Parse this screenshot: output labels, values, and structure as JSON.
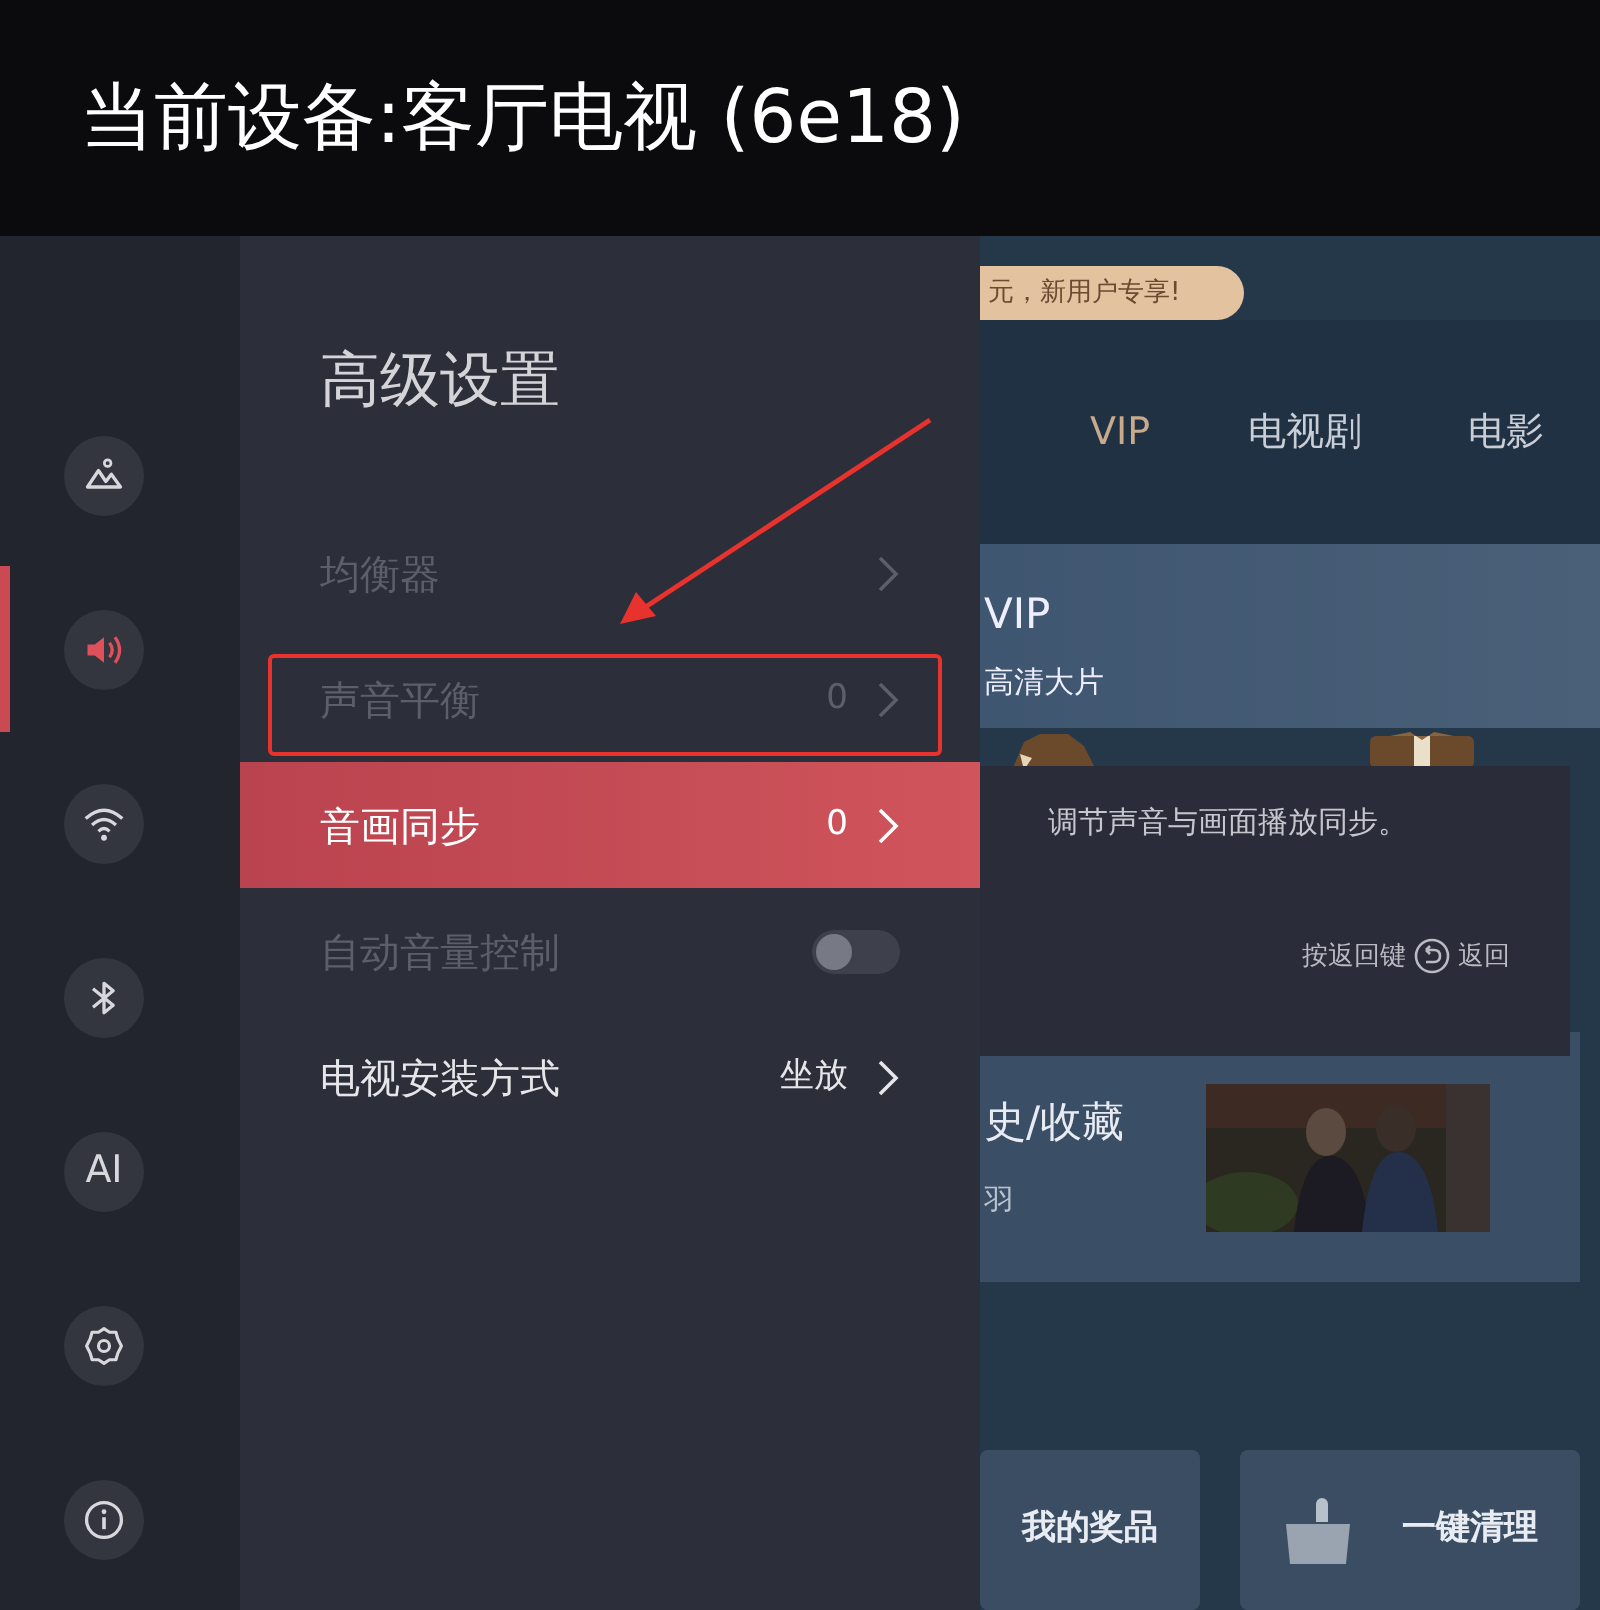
{
  "header": {
    "title": "当前设备:客厅电视 (6e18)"
  },
  "rail": [
    {
      "kind": "picture",
      "selected": false
    },
    {
      "kind": "sound",
      "selected": true
    },
    {
      "kind": "wifi",
      "selected": false
    },
    {
      "kind": "bluetooth",
      "selected": false
    },
    {
      "kind": "text",
      "label": "AI",
      "selected": false
    },
    {
      "kind": "gear",
      "selected": false
    },
    {
      "kind": "info",
      "selected": false
    }
  ],
  "panel": {
    "title": "高级设置",
    "rows": [
      {
        "kind": "link",
        "label": "均衡器",
        "disabled": true,
        "selected": false
      },
      {
        "kind": "link",
        "label": "声音平衡",
        "value": "0",
        "disabled": true,
        "selected": false
      },
      {
        "kind": "link",
        "label": "音画同步",
        "value": "0",
        "disabled": false,
        "selected": true
      },
      {
        "kind": "toggle",
        "label": "自动音量控制",
        "on": false,
        "disabled": true,
        "selected": false
      },
      {
        "kind": "link",
        "label": "电视安装方式",
        "value": "坐放",
        "disabled": false,
        "selected": false
      }
    ]
  },
  "tooltip": {
    "text": "调节声音与画面播放同步。",
    "hint": "按返回键",
    "back": "返回"
  },
  "home": {
    "promo": "元，新用户专享!",
    "tabs": [
      {
        "label": "VIP",
        "color": "#c8a98a"
      },
      {
        "label": "电视剧",
        "color": "#c9ced6"
      },
      {
        "label": "电影",
        "color": "#c9ced6"
      }
    ],
    "vip_card": {
      "title": "VIP",
      "subtitle": "高清大片"
    },
    "history_card": {
      "title": "史/收藏",
      "subtitle": "羽",
      "poster": {
        "kind": "picture"
      }
    },
    "tiles": [
      {
        "label": "我的奖品"
      },
      {
        "label": "一键清理",
        "kind": "broom"
      }
    ]
  },
  "annotations": {
    "arrow": true,
    "frame": true
  }
}
